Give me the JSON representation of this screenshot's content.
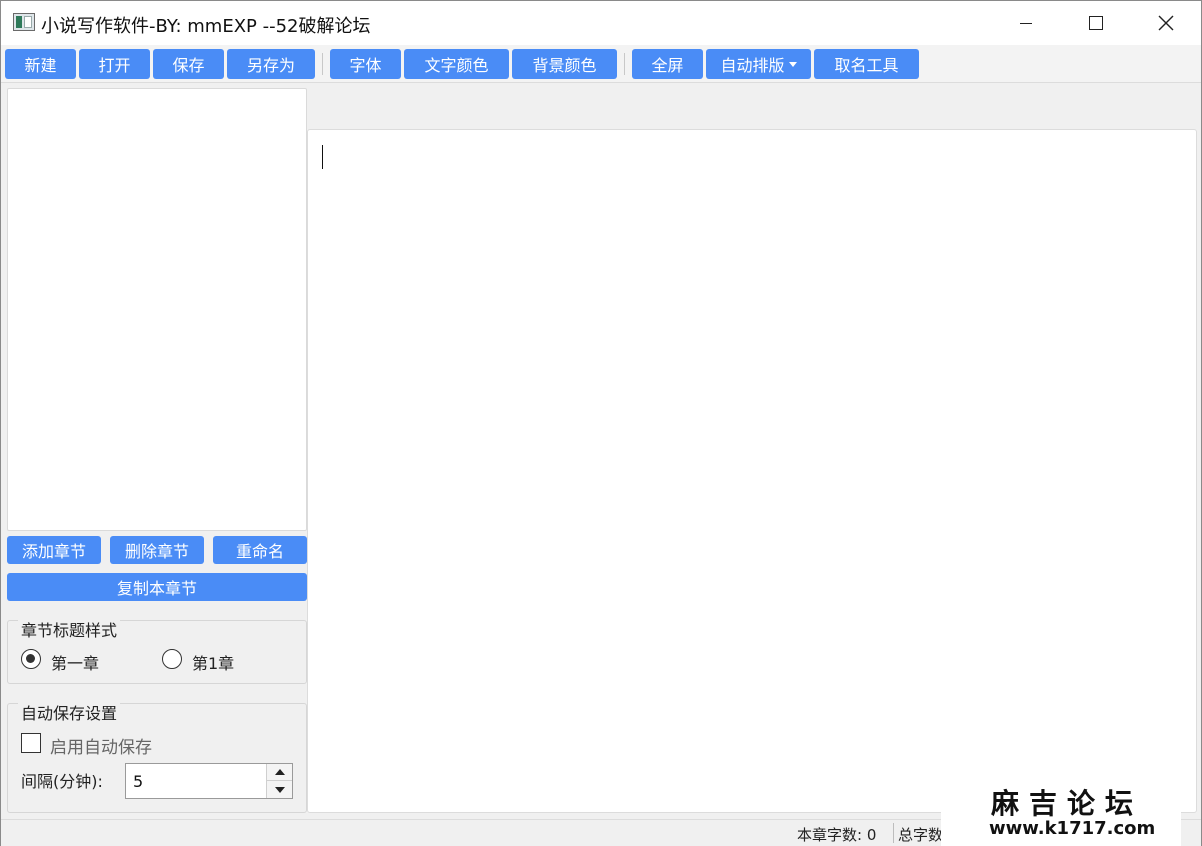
{
  "window": {
    "title": "小说写作软件-BY: mmEXP --52破解论坛",
    "icon": "app-icon",
    "controls": [
      "minimize-icon",
      "maximize-icon",
      "close-icon"
    ]
  },
  "toolbar": {
    "new": "新建",
    "open": "打开",
    "save": "保存",
    "save_as": "另存为",
    "font": "字体",
    "text_color": "文字颜色",
    "bg_color": "背景颜色",
    "fullscreen": "全屏",
    "auto_format": "自动排版",
    "naming_tool": "取名工具"
  },
  "sidebar": {
    "chapters": [],
    "add_chapter": "添加章节",
    "delete_chapter": "删除章节",
    "rename": "重命名",
    "copy_chapter": "复制本章节",
    "title_style": {
      "heading": "章节标题样式",
      "options": [
        "第一章",
        "第1章"
      ],
      "selected": "第一章"
    },
    "autosave": {
      "heading": "自动保存设置",
      "enable_label": "启用自动保存",
      "enabled": false,
      "interval_label": "间隔(分钟):",
      "interval_value": "5"
    }
  },
  "editor": {
    "content": ""
  },
  "statusbar": {
    "chapter_count": "本章字数: 0",
    "total_count": "总字数"
  },
  "watermark": {
    "title": "麻吉论坛",
    "url": "www.k1717.com"
  },
  "colors": {
    "accent": "#4a8cf6",
    "window_bg": "#f0f0f0"
  }
}
